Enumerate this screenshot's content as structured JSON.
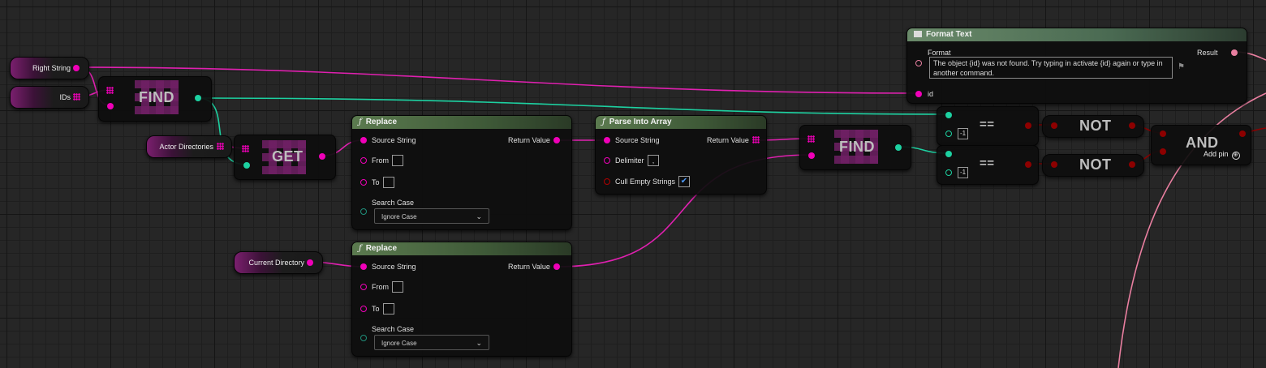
{
  "variables": {
    "right_string": "Right String",
    "ids": "IDs",
    "actor_directories": "Actor Directories",
    "current_directory": "Current Directory"
  },
  "find_1": {
    "label": "FIND"
  },
  "get": {
    "label": "GET"
  },
  "find_2": {
    "label": "FIND"
  },
  "replace_1": {
    "title": "Replace",
    "fn_glyph": "ƒ",
    "source_string": "Source String",
    "from": "From",
    "to": "To",
    "search_case": "Search Case",
    "search_case_value": "Ignore Case",
    "return_value": "Return Value"
  },
  "replace_2": {
    "title": "Replace",
    "fn_glyph": "ƒ",
    "source_string": "Source String",
    "from": "From",
    "to": "To",
    "search_case": "Search Case",
    "search_case_value": "Ignore Case",
    "return_value": "Return Value"
  },
  "parse": {
    "title": "Parse Into Array",
    "fn_glyph": "ƒ",
    "source_string": "Source String",
    "delimiter": "Delimiter",
    "delimiter_value": ",",
    "cull": "Cull Empty Strings",
    "cull_checked": "✔",
    "return_value": "Return Value"
  },
  "format_text": {
    "title": "Format Text",
    "format": "Format",
    "format_value": "The object {id} was not found. Try typing in activate {id} again or type in another command.",
    "id": "id",
    "result": "Result"
  },
  "eq_1": {
    "op": "==",
    "value": "-1"
  },
  "eq_2": {
    "op": "==",
    "value": "-1"
  },
  "not_1": {
    "label": "NOT"
  },
  "not_2": {
    "label": "NOT"
  },
  "and": {
    "label": "AND",
    "add_pin": "Add pin",
    "add_pin_icon": "⊕"
  },
  "colors": {
    "string_pin": "#f000b8",
    "integer_pin": "#1dd1a1",
    "boolean_pin": "#8d0000",
    "text_pin": "#e97fa0",
    "function_header": "#5b7a4f"
  }
}
